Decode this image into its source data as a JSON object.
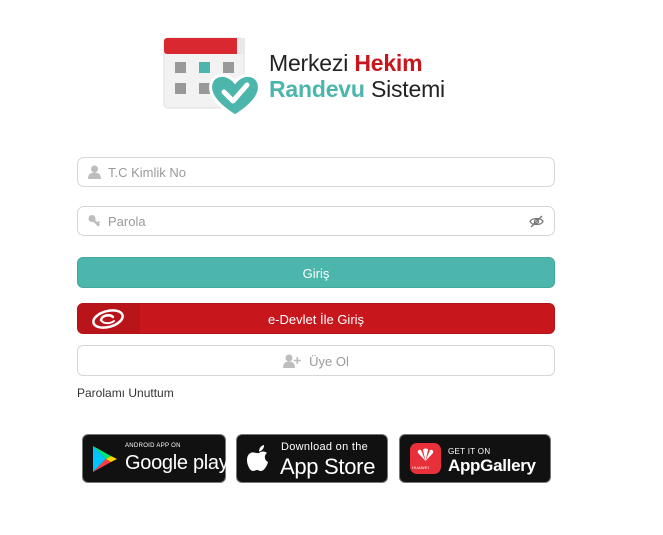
{
  "logo": {
    "line1_a": "Merkezi",
    "line1_b": "Hekim",
    "line2_a": "Randevu",
    "line2_b": "Sistemi",
    "colors": {
      "red": "#c8161d",
      "teal": "#4db6ac"
    }
  },
  "form": {
    "tc_placeholder": "T.C Kimlik No",
    "tc_value": "",
    "password_placeholder": "Parola",
    "password_value": "",
    "tc_icon": "user-icon",
    "password_icon": "key-icon",
    "visibility_icon": "eye-off-icon"
  },
  "buttons": {
    "login": "Giriş",
    "edevlet": "e-Devlet İle Giriş",
    "register": "Üye Ol",
    "register_icon": "user-plus-icon",
    "colors": {
      "login_bg": "#4db6ac",
      "edevlet_bg": "#c8161d"
    }
  },
  "forgot_password": "Parolamı Unuttum",
  "stores": {
    "google": {
      "small": "ANDROID APP ON",
      "big": "Google play"
    },
    "apple": {
      "small": "Download on the",
      "big": "App Store"
    },
    "huawei": {
      "small": "GET IT ON",
      "big": "AppGallery",
      "logo_text": "HUAWEI"
    }
  }
}
